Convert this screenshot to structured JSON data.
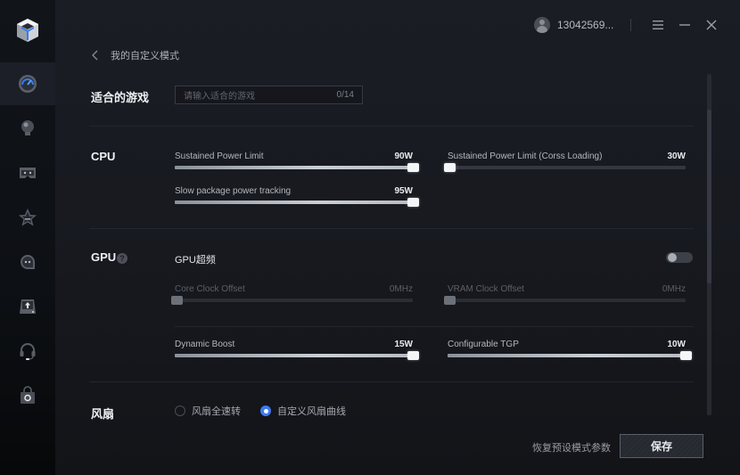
{
  "sidebar": {
    "logo": "cube-logo",
    "items": [
      {
        "icon": "speedometer-icon",
        "active": true
      },
      {
        "icon": "lightbulb-icon",
        "active": false
      },
      {
        "icon": "gamepad-icon",
        "active": false
      },
      {
        "icon": "star-icon",
        "active": false
      },
      {
        "icon": "chat-bubble-icon",
        "active": false
      },
      {
        "icon": "upload-tray-icon",
        "active": false
      },
      {
        "icon": "headset-icon",
        "active": false
      },
      {
        "icon": "shopping-bag-icon",
        "active": false
      }
    ]
  },
  "topbar": {
    "username": "13042569...",
    "menu_icon": "hamburger-icon",
    "minimize_icon": "minimize-icon",
    "close_icon": "close-icon"
  },
  "breadcrumb": {
    "back_icon": "chevron-left-icon",
    "title": "我的自定义模式"
  },
  "game_section": {
    "title": "适合的游戏",
    "input_placeholder": "请输入适合的游戏",
    "input_value": "",
    "char_count": "0/14"
  },
  "cpu_section": {
    "title": "CPU",
    "sliders": [
      {
        "label": "Sustained Power Limit",
        "value": "90W",
        "fraction": 1.0,
        "disabled": false
      },
      {
        "label": "Sustained Power Limit (Corss Loading)",
        "value": "30W",
        "fraction": 0.0,
        "disabled": false
      },
      {
        "label": "Slow package power tracking",
        "value": "95W",
        "fraction": 1.0,
        "disabled": false
      }
    ]
  },
  "gpu_section": {
    "title": "GPU",
    "help_icon": "question-circle-icon",
    "help_glyph": "?",
    "overclock_label": "GPU超频",
    "overclock_enabled": false,
    "sliders": [
      {
        "label": "Core Clock Offset",
        "value": "0MHz",
        "fraction": 0.0,
        "disabled": true
      },
      {
        "label": "VRAM Clock Offset",
        "value": "0MHz",
        "fraction": 0.0,
        "disabled": true
      },
      {
        "label": "Dynamic Boost",
        "value": "15W",
        "fraction": 1.0,
        "disabled": false
      },
      {
        "label": "Configurable TGP",
        "value": "10W",
        "fraction": 1.0,
        "disabled": false
      }
    ]
  },
  "fan_section": {
    "title": "风扇",
    "options": [
      {
        "label": "风扇全速转",
        "checked": false
      },
      {
        "label": "自定义风扇曲线",
        "checked": true
      }
    ]
  },
  "footer": {
    "reset_label": "恢复预设模式参数",
    "save_label": "保存"
  },
  "colors": {
    "accent": "#3e7bf0",
    "background": "#17191f",
    "sidebar": "#0d1014"
  }
}
